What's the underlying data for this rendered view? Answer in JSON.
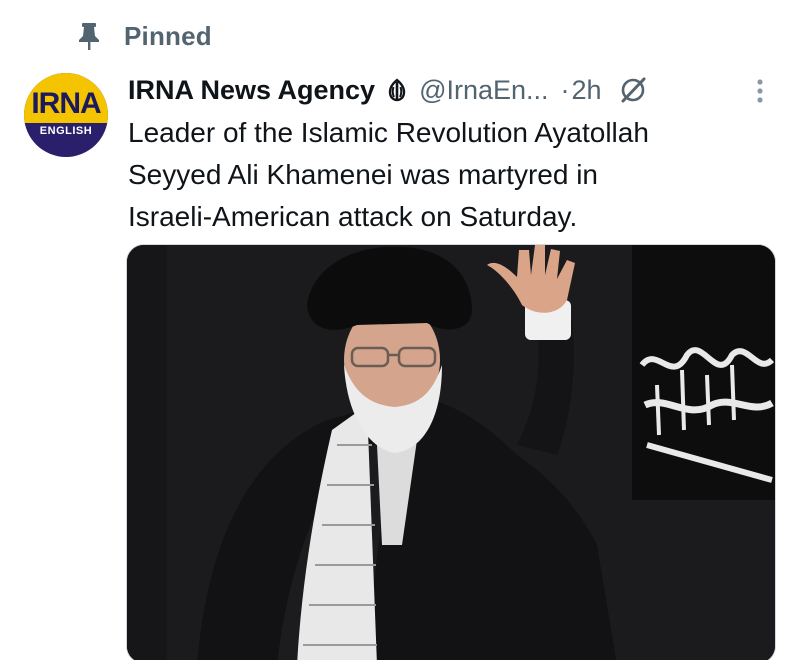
{
  "pinned": {
    "label": "Pinned",
    "icon": "pin-icon"
  },
  "author": {
    "display_name": "IRNA News Agency",
    "handle": "@IrnaEn...",
    "badge_icon": "government-emblem-icon",
    "avatar": {
      "brand": "IRNA",
      "sub": "ENGLISH"
    }
  },
  "meta": {
    "separator": "·",
    "time": "2h"
  },
  "actions": {
    "grok_icon": "grok-icon",
    "more_icon": "more-options-icon"
  },
  "tweet": {
    "lines": [
      "Leader of the Islamic Revolution Ayatollah",
      "Seyyed Ali Khamenei was martyred in",
      "Israeli-American attack on Saturday."
    ]
  },
  "media": {
    "kind": "photo",
    "subject": "cleric-waving"
  },
  "colors": {
    "text_primary": "#0f1419",
    "text_secondary": "#536471",
    "avatar_yellow": "#f5c400",
    "avatar_navy": "#2a1f6b",
    "photo_bg": "#1a1a1c"
  }
}
